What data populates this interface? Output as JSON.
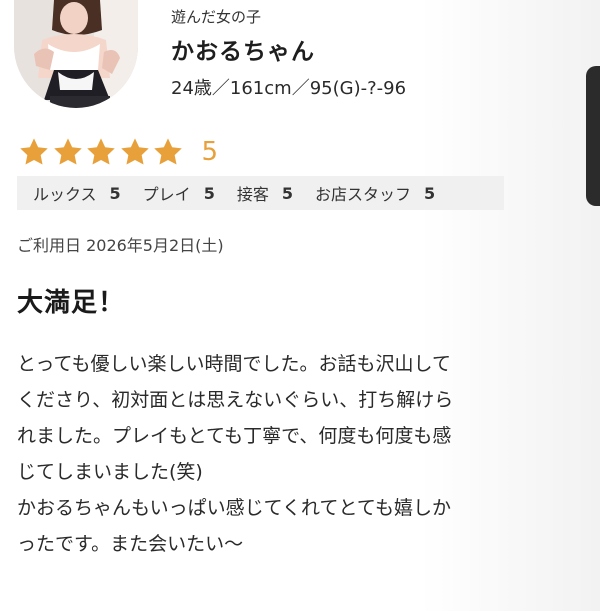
{
  "profile": {
    "label": "遊んだ女の子",
    "name": "かおるちゃん",
    "stats": "24歳／161cm／95(G)-?-96"
  },
  "rating": {
    "stars": 5,
    "max_stars": 5,
    "score": "5",
    "star_color": "#e8a13a",
    "categories": [
      {
        "label": "ルックス",
        "value": "5"
      },
      {
        "label": "プレイ",
        "value": "5"
      },
      {
        "label": "接客",
        "value": "5"
      },
      {
        "label": "お店スタッフ",
        "value": "5"
      }
    ]
  },
  "review": {
    "date": "ご利用日 2026年5月2日(土)",
    "title": "大満足！",
    "lines": [
      "とっても優しい楽しい時間でした。お話も沢山して",
      "くださり、初対面とは思えないぐらい、打ち解けら",
      "れました。プレイもとても丁寧で、何度も何度も感",
      "じてしまいました(笑)",
      "かおるちゃんもいっぱい感じてくれてとても嬉しか",
      "ったです。また会いたい〜"
    ]
  }
}
